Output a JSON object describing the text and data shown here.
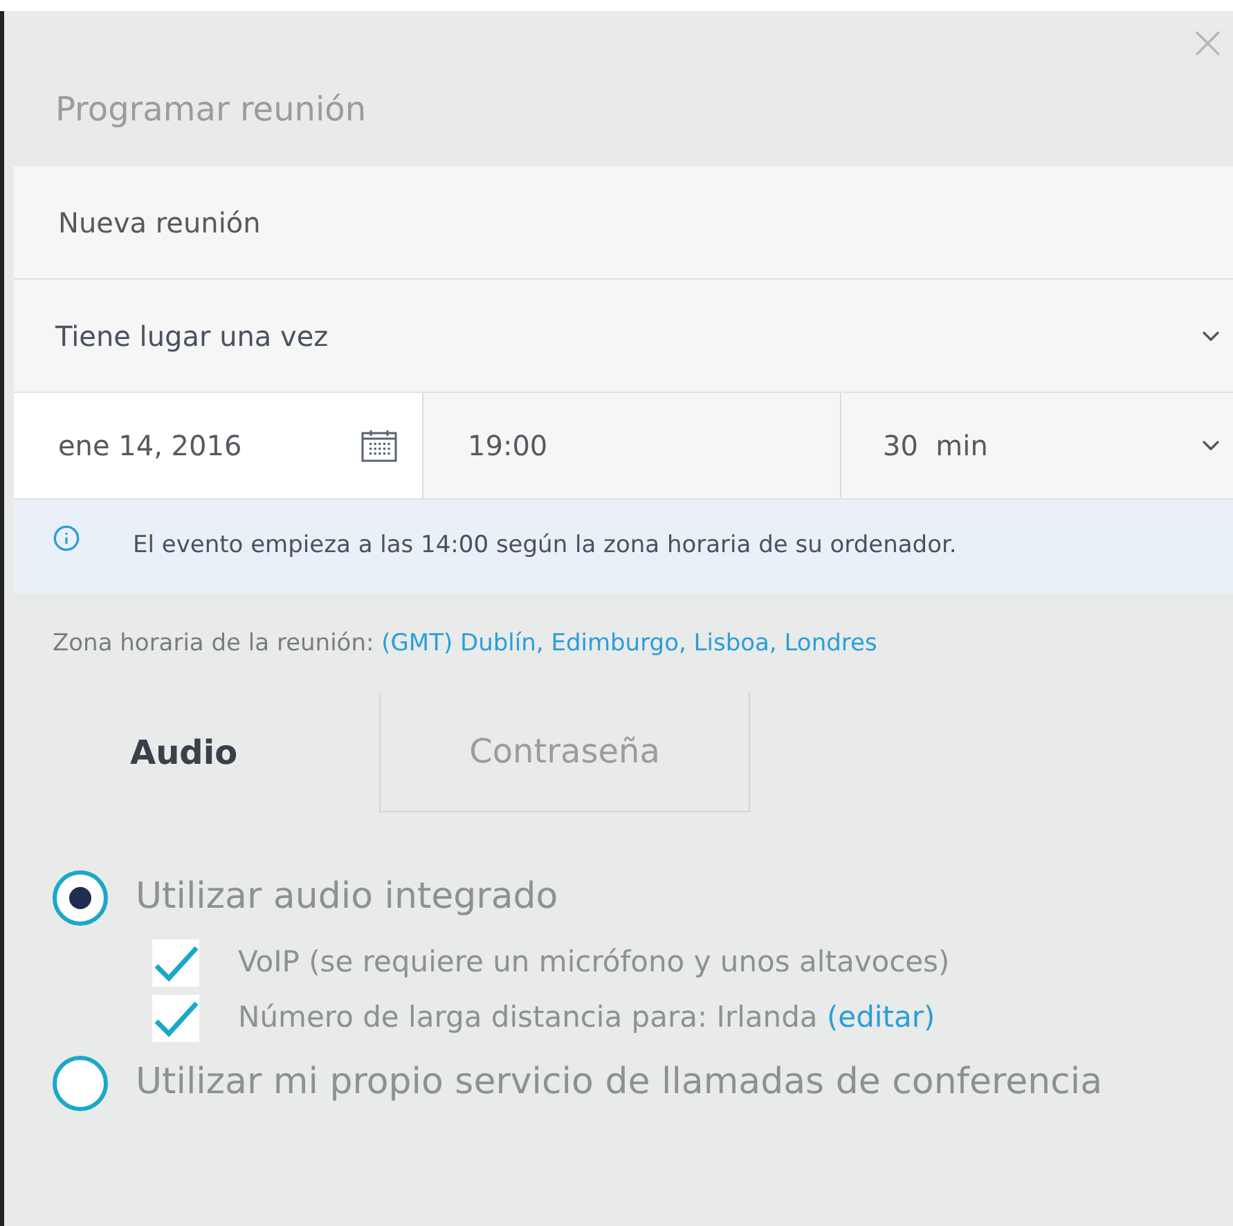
{
  "dialog": {
    "title": "Programar reunión",
    "close": "×"
  },
  "meeting_name": {
    "value": "Nueva reunión"
  },
  "recurrence": {
    "value": "Tiene lugar una vez"
  },
  "date": {
    "value": "ene 14, 2016"
  },
  "time": {
    "value": "19:00"
  },
  "duration": {
    "value": "30",
    "unit": "min"
  },
  "info": {
    "text": "El evento empieza a las 14:00 según la zona horaria de su ordenador."
  },
  "timezone": {
    "label": "Zona horaria de la reunión:",
    "link": "(GMT) Dublín, Edimburgo, Lisboa, Londres"
  },
  "tabs": [
    {
      "label": "Audio",
      "selected": true
    },
    {
      "label": "Contraseña",
      "selected": false
    }
  ],
  "audio_options": [
    {
      "kind": "radio",
      "label": "Utilizar audio integrado",
      "selected": true
    },
    {
      "kind": "checkbox",
      "label": "VoIP (se requiere un micrófono y unos altavoces)",
      "checked": true
    },
    {
      "kind": "checkbox",
      "label": "Número de larga distancia para: Irlanda",
      "link": "(editar)",
      "checked": true
    },
    {
      "kind": "radio",
      "label": "Utilizar mi propio servicio de llamadas de conferencia",
      "selected": false
    }
  ]
}
